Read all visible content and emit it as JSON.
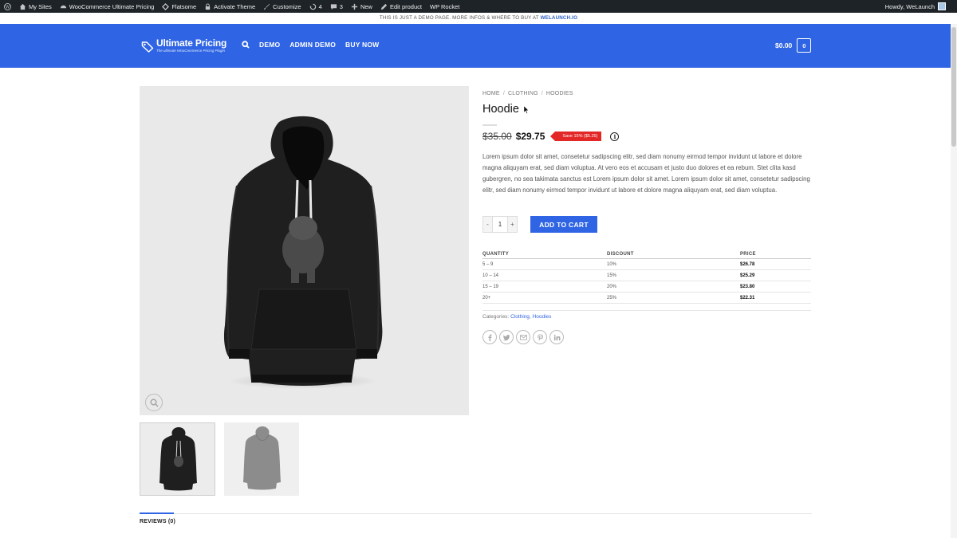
{
  "admin_bar": {
    "items": [
      {
        "label": "My Sites",
        "icon": "home-icon"
      },
      {
        "label": "WooCommerce Ultimate Pricing",
        "icon": "dashboard-icon"
      },
      {
        "label": "Flatsome",
        "icon": "flatsome-icon"
      },
      {
        "label": "Activate Theme",
        "icon": "lock-icon"
      },
      {
        "label": "Customize",
        "icon": "brush-icon"
      },
      {
        "label": "4",
        "icon": "updates-icon"
      },
      {
        "label": "3",
        "icon": "comment-icon"
      },
      {
        "label": "New",
        "icon": "plus-icon"
      },
      {
        "label": "Edit product",
        "icon": "pencil-icon"
      },
      {
        "label": "WP Rocket",
        "icon": ""
      }
    ],
    "howdy": "Howdy, WeLaunch"
  },
  "topbar": {
    "text": "THIS IS JUST A DEMO PAGE. MORE INFOS & WHERE TO BUY AT",
    "link": "WELAUNCH.IO"
  },
  "header": {
    "logo_title": "Ultimate Pricing",
    "logo_subtitle": "The ultimate WooCommerce Pricing Plugin",
    "nav": [
      "DEMO",
      "ADMIN DEMO",
      "BUY NOW"
    ],
    "cart_total": "$0.00",
    "cart_count": "0"
  },
  "breadcrumb": [
    "HOME",
    "CLOTHING",
    "HOODIES"
  ],
  "breadcrumb_sep": "/",
  "product": {
    "title": "Hoodie",
    "price_old": "$35.00",
    "price_new": "$29.75",
    "save_badge": "Save 15% ($5.25)",
    "info_icon": "i",
    "description": "Lorem ipsum dolor sit amet, consetetur sadipscing elitr, sed diam nonumy eirmod tempor invidunt ut labore et dolore magna aliquyam erat, sed diam voluptua. At vero eos et accusam et justo duo dolores et ea rebum. Stet clita kasd gubergren, no sea takimata sanctus est Lorem ipsum dolor sit amet. Lorem ipsum dolor sit amet, consetetur sadipscing elitr, sed diam nonumy eirmod tempor invidunt ut labore et dolore magna aliquyam erat, sed diam voluptua.",
    "quantity": "1",
    "qty_minus": "-",
    "qty_plus": "+",
    "add_to_cart": "ADD TO CART",
    "image_color": "#1f1f1f",
    "alt_image_color": "#8c8c8c"
  },
  "pricing_table": {
    "headers": [
      "QUANTITY",
      "DISCOUNT",
      "PRICE"
    ],
    "rows": [
      [
        "5 – 9",
        "10%",
        "$26.78"
      ],
      [
        "10 – 14",
        "15%",
        "$25.29"
      ],
      [
        "15 – 19",
        "20%",
        "$23.80"
      ],
      [
        "20+",
        "25%",
        "$22.31"
      ]
    ]
  },
  "categories": {
    "label": "Categories:",
    "items": [
      "Clothing",
      "Hoodies"
    ],
    "separator": ","
  },
  "share_icons": [
    "facebook-icon",
    "twitter-icon",
    "email-icon",
    "pinterest-icon",
    "linkedin-icon"
  ],
  "tabs": [
    {
      "label": "REVIEWS (0)",
      "active": true
    }
  ],
  "colors": {
    "brand_blue": "#2f64e4",
    "sale_red": "#e32626",
    "admin_bar": "#1d2327"
  }
}
